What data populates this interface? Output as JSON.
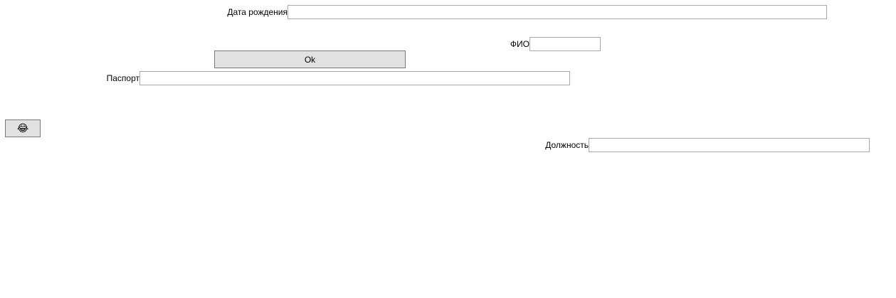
{
  "form": {
    "birth_date": {
      "label": "Дата рождения",
      "value": ""
    },
    "full_name": {
      "label": "ФИО",
      "value": ""
    },
    "ok_button": {
      "label": "Ok"
    },
    "passport": {
      "label": "Паспорт",
      "value": ""
    },
    "emoji_button": {
      "label": "😂",
      "icon": "laughing-face-icon"
    },
    "position": {
      "label": "Должность",
      "value": ""
    }
  }
}
